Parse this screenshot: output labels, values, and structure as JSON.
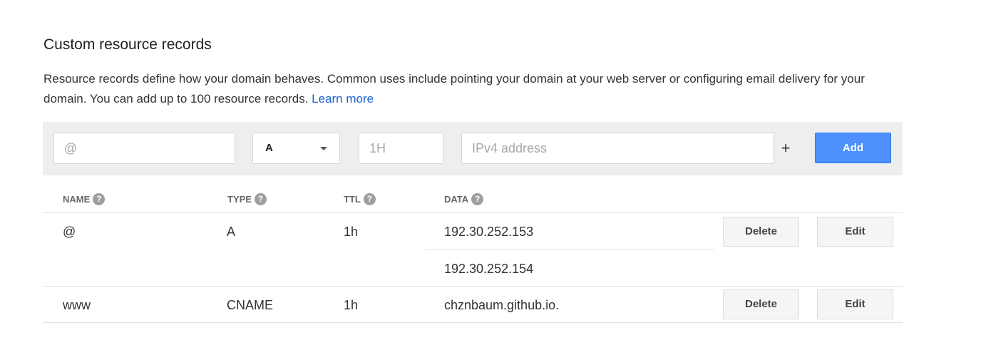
{
  "section": {
    "title": "Custom resource records",
    "description": "Resource records define how your domain behaves. Common uses include pointing your domain at your web server or configuring email delivery for your domain. You can add up to 100 resource records.",
    "learn_more": "Learn more"
  },
  "add_form": {
    "name_placeholder": "@",
    "type_value": "A",
    "ttl_placeholder": "1H",
    "data_placeholder": "IPv4 address",
    "plus_label": "+",
    "add_label": "Add"
  },
  "table": {
    "headers": {
      "name": "NAME",
      "type": "TYPE",
      "ttl": "TTL",
      "data": "DATA",
      "help_glyph": "?"
    },
    "rows": [
      {
        "name": "@",
        "type": "A",
        "ttl": "1h",
        "data": [
          "192.30.252.153",
          "192.30.252.154"
        ],
        "delete_label": "Delete",
        "edit_label": "Edit"
      },
      {
        "name": "www",
        "type": "CNAME",
        "ttl": "1h",
        "data": [
          "chznbaum.github.io."
        ],
        "delete_label": "Delete",
        "edit_label": "Edit"
      }
    ]
  },
  "colors": {
    "accent": "#4d90fe",
    "link": "#1a62d2"
  }
}
